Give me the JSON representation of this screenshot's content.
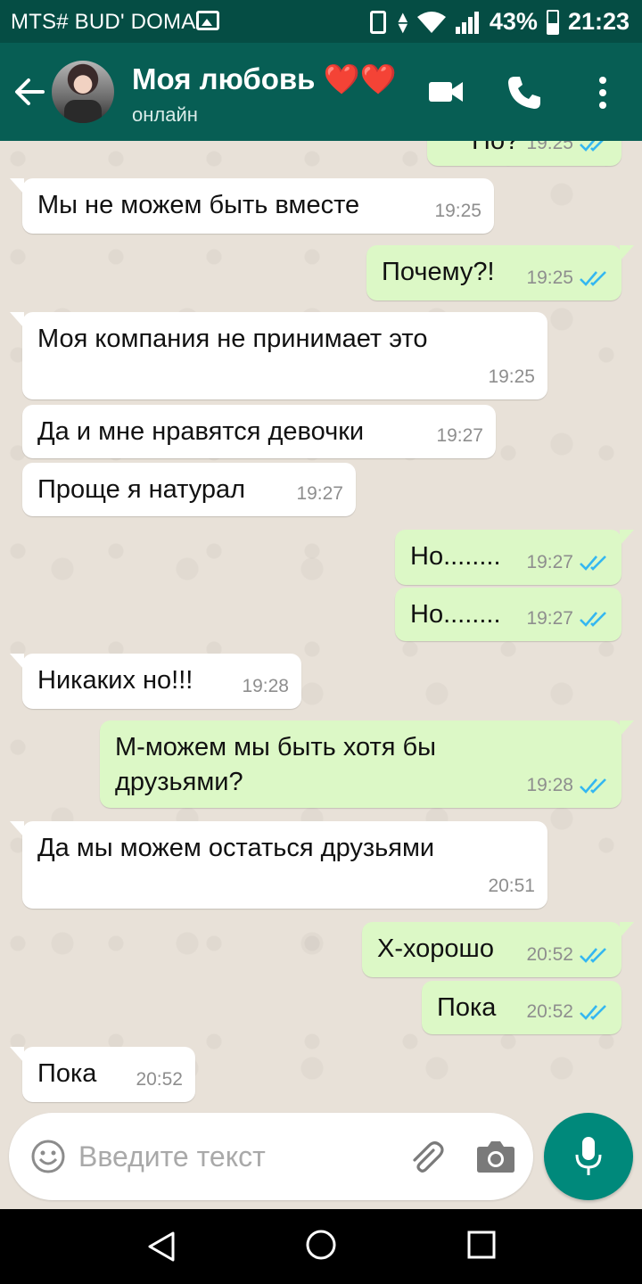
{
  "status_bar": {
    "carrier": "MTS# BUD' DOMA",
    "battery": "43%",
    "time": "21:23"
  },
  "header": {
    "contact_name": "Моя любовь ❤️❤️",
    "status": "онлайн"
  },
  "messages": [
    {
      "dir": "out",
      "text": "Но?",
      "time": "19:25",
      "read": true
    },
    {
      "dir": "in",
      "text": "Мы не можем быть вместе",
      "time": "19:25"
    },
    {
      "dir": "out",
      "text": "Почему?!",
      "time": "19:25",
      "read": true
    },
    {
      "dir": "in",
      "text": "Моя компания не принимает это",
      "time": "19:25"
    },
    {
      "dir": "in",
      "text": "Да и мне нравятся девочки",
      "time": "19:27"
    },
    {
      "dir": "in",
      "text": "Проще я натурал",
      "time": "19:27"
    },
    {
      "dir": "out",
      "text": "Но........",
      "time": "19:27",
      "read": true
    },
    {
      "dir": "out",
      "text": "Но........",
      "time": "19:27",
      "read": true
    },
    {
      "dir": "in",
      "text": "Никаких но!!!",
      "time": "19:28"
    },
    {
      "dir": "out",
      "text": "М-можем мы быть хотя бы\nдрузьями?",
      "time": "19:28",
      "read": true
    },
    {
      "dir": "in",
      "text": "Да мы можем остаться друзьями",
      "time": "20:51"
    },
    {
      "dir": "out",
      "text": "Х-хорошо",
      "time": "20:52",
      "read": true
    },
    {
      "dir": "out",
      "text": "Пока",
      "time": "20:52",
      "read": true
    },
    {
      "dir": "in",
      "text": "Пока",
      "time": "20:52"
    }
  ],
  "composer": {
    "placeholder": "Введите текст",
    "value": ""
  },
  "colors": {
    "header": "#075e54",
    "status_bar": "#054d44",
    "outgoing": "#dcf8c6",
    "incoming": "#ffffff",
    "read_ticks": "#34b7f1",
    "mic": "#00897b"
  },
  "icons": [
    "back-arrow-icon",
    "video-call-icon",
    "phone-icon",
    "more-vert-icon",
    "emoji-icon",
    "attach-icon",
    "camera-icon",
    "mic-icon"
  ]
}
